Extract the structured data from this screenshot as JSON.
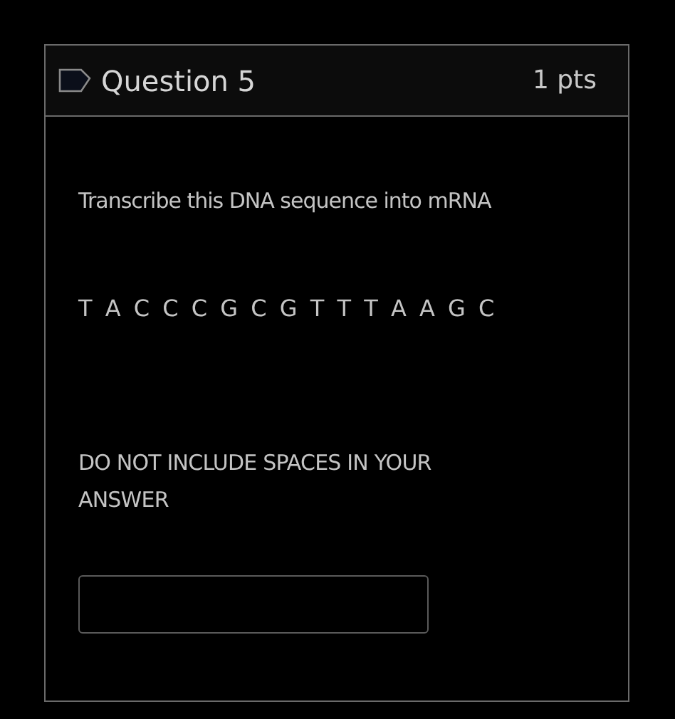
{
  "question": {
    "title": "Question 5",
    "points": "1 pts",
    "prompt": "Transcribe this DNA sequence into mRNA",
    "sequence": "T A C C C G C G T T T A A G C",
    "instruction": "DO NOT INCLUDE SPACES IN YOUR ANSWER"
  }
}
